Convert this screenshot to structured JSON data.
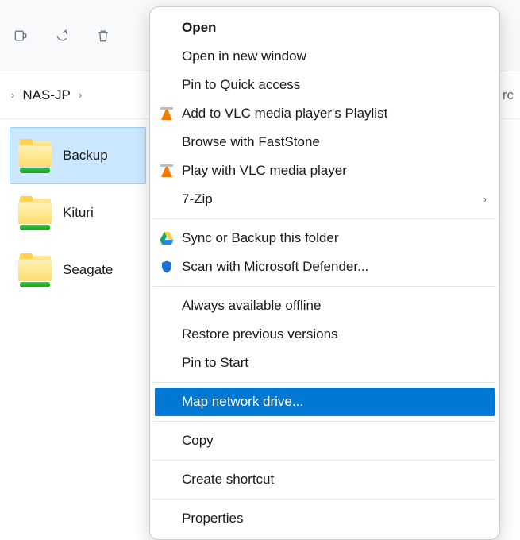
{
  "breadcrumb": {
    "location": "NAS-JP",
    "right_fragment": "rc"
  },
  "folders": [
    {
      "name": "Backup",
      "selected": true
    },
    {
      "name": "Kituri",
      "selected": false
    },
    {
      "name": "Seagate",
      "selected": false
    }
  ],
  "context_menu": {
    "groups": [
      [
        {
          "label": "Open",
          "bold": true,
          "icon": null
        },
        {
          "label": "Open in new window",
          "icon": null
        },
        {
          "label": "Pin to Quick access",
          "icon": null
        },
        {
          "label": "Add to VLC media player's Playlist",
          "icon": "vlc"
        },
        {
          "label": "Browse with FastStone",
          "icon": null
        },
        {
          "label": "Play with VLC media player",
          "icon": "vlc"
        },
        {
          "label": "7-Zip",
          "icon": null,
          "submenu": true
        }
      ],
      [
        {
          "label": "Sync or Backup this folder",
          "icon": "gdrive"
        },
        {
          "label": "Scan with Microsoft Defender...",
          "icon": "shield"
        }
      ],
      [
        {
          "label": "Always available offline",
          "icon": null
        },
        {
          "label": "Restore previous versions",
          "icon": null
        },
        {
          "label": "Pin to Start",
          "icon": null
        }
      ],
      [
        {
          "label": "Map network drive...",
          "icon": null,
          "highlighted": true
        }
      ],
      [
        {
          "label": "Copy",
          "icon": null
        }
      ],
      [
        {
          "label": "Create shortcut",
          "icon": null
        }
      ],
      [
        {
          "label": "Properties",
          "icon": null
        }
      ]
    ]
  }
}
